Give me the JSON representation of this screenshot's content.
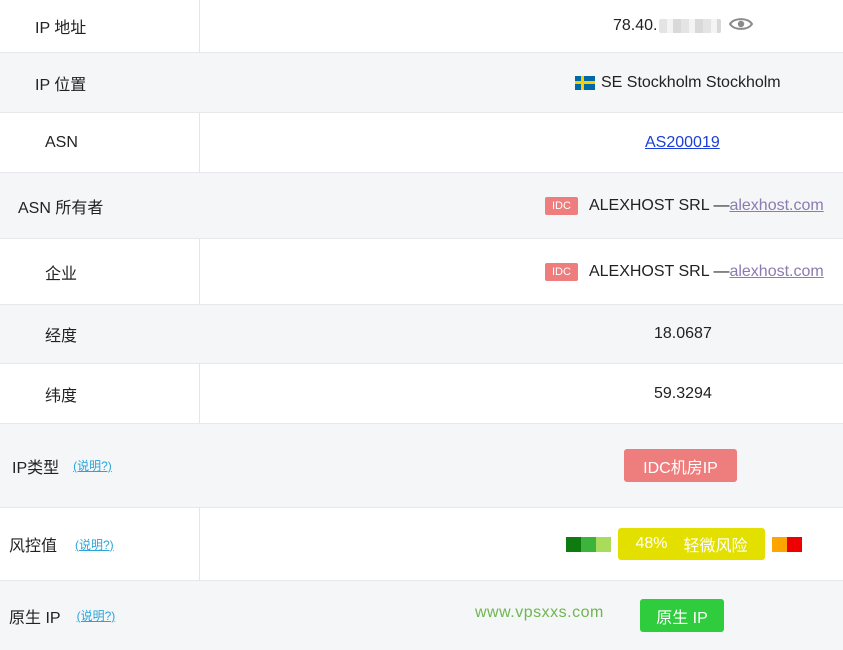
{
  "rows": {
    "ip_address": {
      "label": "IP 地址",
      "value": "78.40."
    },
    "ip_location": {
      "label": "IP 位置",
      "value": "SE Stockholm Stockholm"
    },
    "asn": {
      "label": "ASN",
      "value": "AS200019"
    },
    "asn_owner": {
      "label": "ASN 所有者",
      "tag": "IDC",
      "name": "ALEXHOST SRL —",
      "link": "alexhost.com"
    },
    "company": {
      "label": "企业",
      "tag": "IDC",
      "name": "ALEXHOST SRL —",
      "link": "alexhost.com"
    },
    "longitude": {
      "label": "经度",
      "value": "18.0687"
    },
    "latitude": {
      "label": "纬度",
      "value": "59.3294"
    },
    "ip_type": {
      "label": "IP类型",
      "help": "(说明?)",
      "badge": "IDC机房IP"
    },
    "risk": {
      "label": "风控值",
      "help": "(说明?)",
      "percent": "48%",
      "level": "轻微风险"
    },
    "native_ip": {
      "label": "原生 IP",
      "help": "(说明?)",
      "watermark": "www.vpsxxs.com",
      "badge": "原生 IP"
    }
  },
  "colors": {
    "idc_red": "#ee7d7d",
    "risk_yellow": "#e3e000",
    "native_green": "#2fcc3e",
    "link_blue": "#1a3fd6",
    "help_cyan": "#2aa5d8"
  },
  "icons": {
    "visibility": "eye-icon",
    "flag": "sweden-flag-icon"
  }
}
